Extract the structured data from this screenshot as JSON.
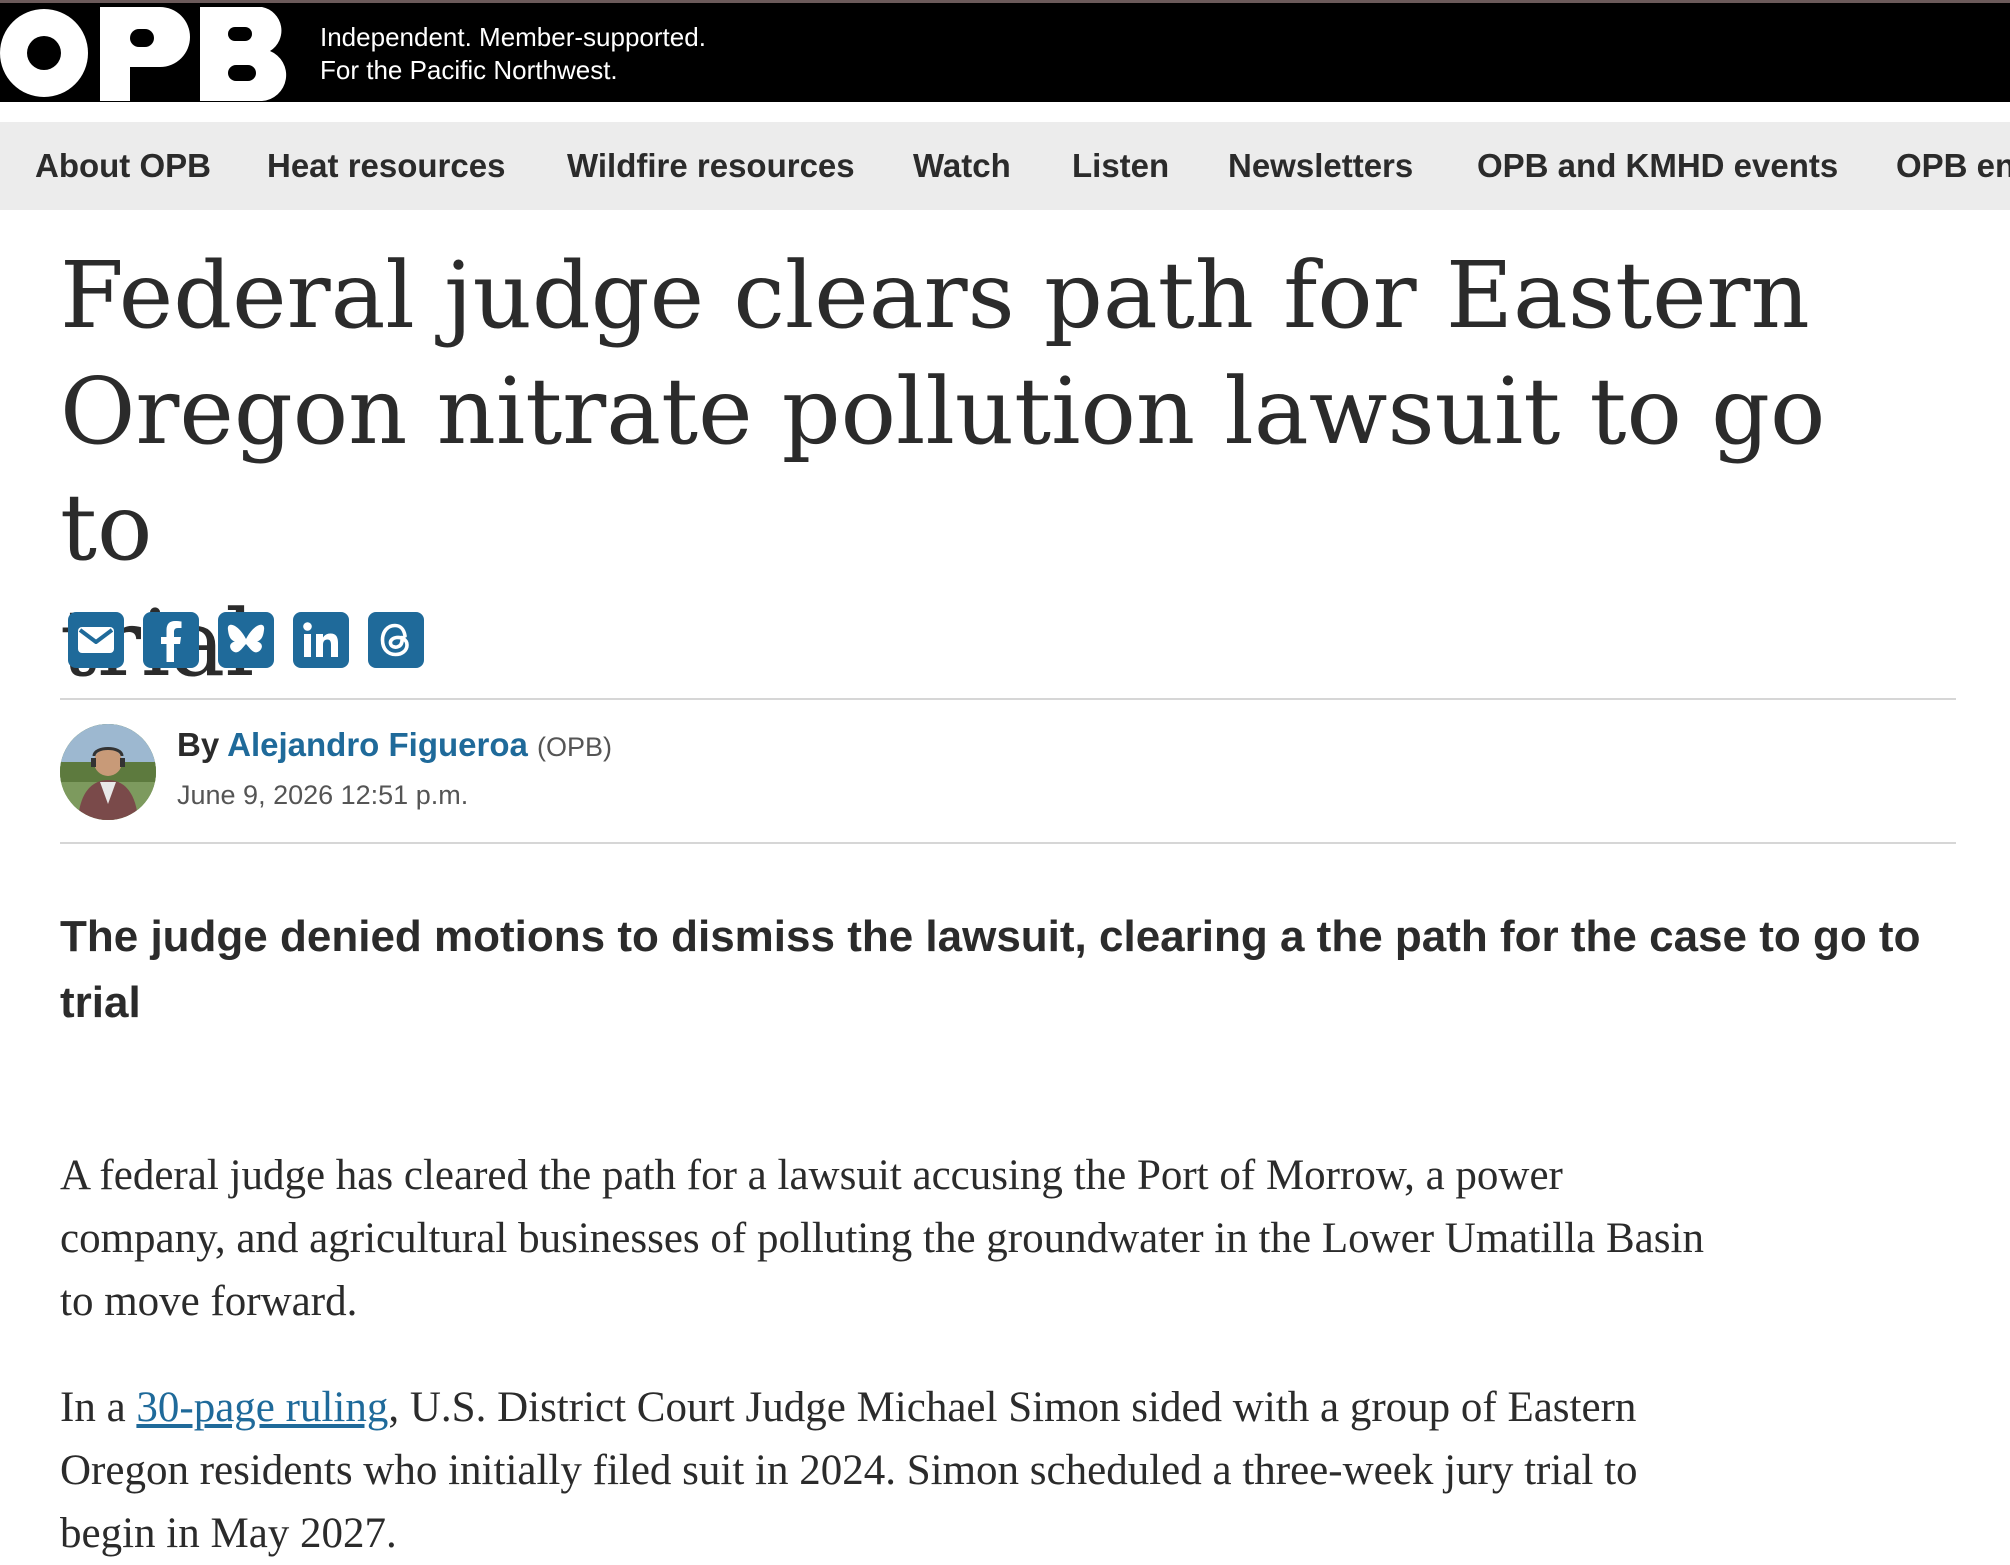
{
  "header": {
    "logo_text": "OPB",
    "tagline_line1": "Independent. Member-supported.",
    "tagline_line2": "For the Pacific Northwest."
  },
  "nav": {
    "items": [
      {
        "label": "About OPB"
      },
      {
        "label": "Heat resources"
      },
      {
        "label": "Wildfire resources"
      },
      {
        "label": "Watch"
      },
      {
        "label": "Listen"
      },
      {
        "label": "Newsletters"
      },
      {
        "label": "OPB and KMHD events"
      },
      {
        "label": "OPB en"
      }
    ]
  },
  "article": {
    "headline_line1": "Federal judge clears path for Eastern",
    "headline_line2": "Oregon nitrate pollution lawsuit to go to",
    "headline_line3": "trial",
    "share_icons": [
      "email-icon",
      "facebook-icon",
      "bluesky-icon",
      "linkedin-icon",
      "threads-icon"
    ],
    "byline_prefix": "By",
    "author": "Alejandro Figueroa",
    "author_org": "(OPB)",
    "date": "June 9, 2026 12:51 p.m.",
    "dek_line1": "The judge denied motions to dismiss the lawsuit, clearing a the path for the case to go to",
    "dek_line2": "trial",
    "p1_line1": "A federal judge has cleared the path for a lawsuit accusing the Port of Morrow, a power",
    "p1_line2": "company, and agricultural businesses of polluting the groundwater in the Lower Umatilla Basin",
    "p1_line3": "to move forward.",
    "p2_prefix": "In a ",
    "p2_link": "30-page ruling",
    "p2_line1_rest": ", U.S. District Court Judge Michael Simon sided with a group of Eastern",
    "p2_line2": "Oregon residents who initially filed suit in 2024. Simon scheduled a three-week jury trial to",
    "p2_line3": "begin in May 2027."
  },
  "colors": {
    "header_bg": "#000000",
    "nav_bg": "#ececec",
    "accent": "#1f6a9a",
    "text": "#2b2b2b"
  }
}
